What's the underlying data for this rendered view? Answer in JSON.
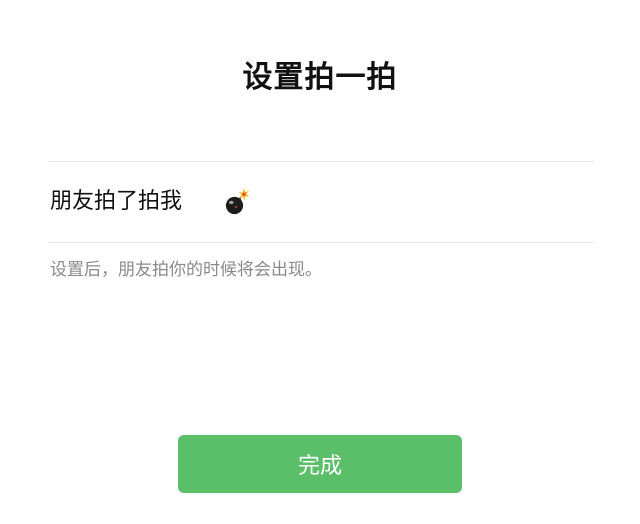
{
  "header": {
    "title": "设置拍一拍"
  },
  "pat_setting": {
    "prefix": "朋友拍了拍我",
    "suffix_icon": "bomb-icon",
    "hint": "设置后，朋友拍你的时候将会出现。"
  },
  "actions": {
    "done_label": "完成"
  },
  "colors": {
    "accent": "#5bbf6a",
    "hint": "#8a8a8a",
    "divider": "#e8e8e8"
  }
}
